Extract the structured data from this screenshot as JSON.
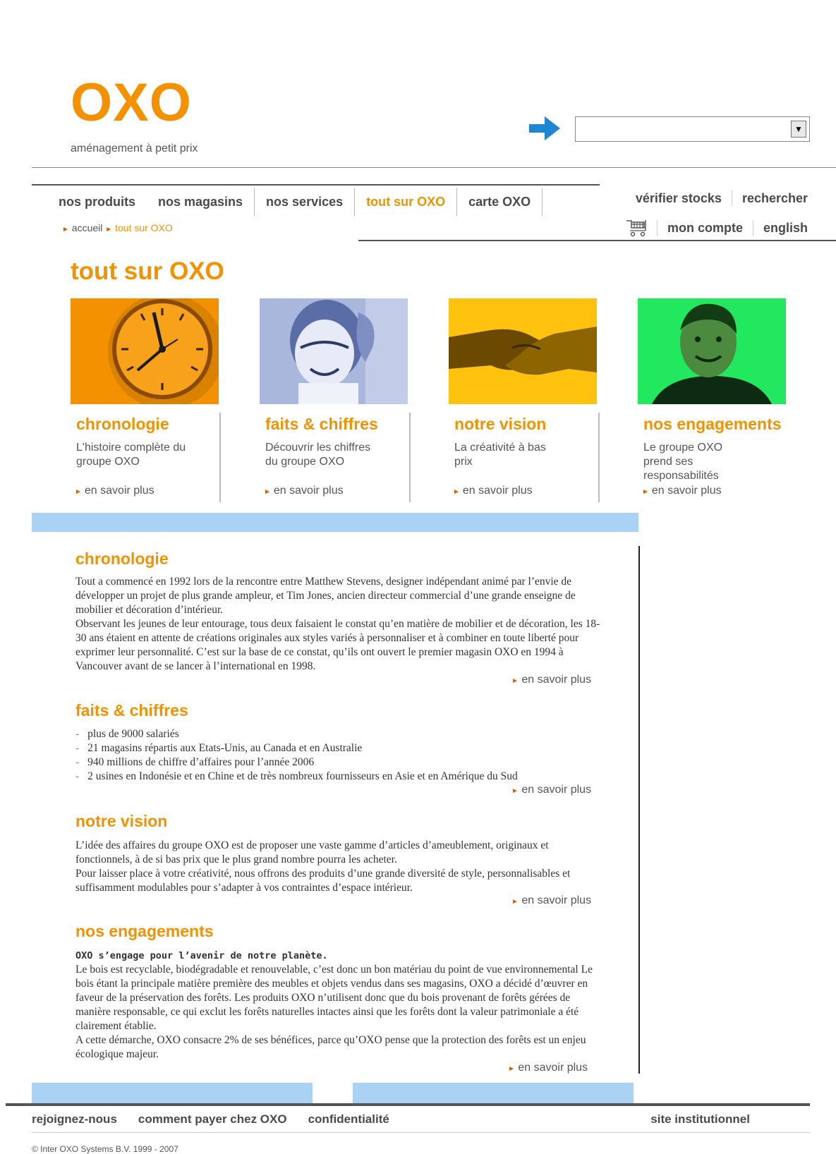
{
  "brand": {
    "logo": "OXO",
    "tagline": "aménagement à petit prix"
  },
  "search": {
    "arrow_icon": "right-arrow-icon",
    "dropdown_value": ""
  },
  "main_nav": [
    {
      "label": "nos produits",
      "active": false
    },
    {
      "label": "nos magasins",
      "active": false
    },
    {
      "label": "nos services",
      "active": false
    },
    {
      "label": "tout sur OXO",
      "active": true
    },
    {
      "label": "carte OXO",
      "active": false
    }
  ],
  "breadcrumb": {
    "items": [
      "accueil",
      "tout sur OXO"
    ]
  },
  "util_nav": {
    "check_stock": "vérifier stocks",
    "search": "rechercher",
    "account": "mon compte",
    "language": "english",
    "cart_icon": "shopping-cart-icon"
  },
  "page": {
    "title": "tout sur OXO"
  },
  "cards": [
    {
      "title": "chronologie",
      "desc": "L'histoire complète du groupe OXO",
      "more": "en savoir plus",
      "image": "clock-image",
      "color": "#f39100"
    },
    {
      "title": "faits & chiffres",
      "desc": "Découvrir les chiffres du groupe OXO",
      "more": "en savoir plus",
      "image": "child-image",
      "color": "#8a9cc7"
    },
    {
      "title": "notre vision",
      "desc": "La créativité à bas prix",
      "more": "en savoir plus",
      "image": "handshake-image",
      "color": "#f8c400"
    },
    {
      "title": "nos engagements",
      "desc": "Le groupe OXO prend ses responsabilités",
      "more": "en savoir plus",
      "image": "man-portrait-image",
      "color": "#1fe85a"
    }
  ],
  "sections": {
    "chronologie": {
      "title": "chronologie",
      "paragraphs": [
        "Tout a commencé en 1992 lors de la rencontre entre Matthew Stevens, designer indépendant animé par l’envie de développer un projet de plus grande ampleur, et Tim Jones, ancien directeur commercial d’une grande enseigne de mobilier et décoration d’intérieur.",
        "Observant les jeunes de leur entourage, tous deux faisaient le constat qu’en matière de mobilier et de décoration, les 18-30 ans étaient en attente de créations originales aux styles variés à personnaliser et à combiner en toute liberté pour exprimer leur personnalité. C’est sur la base de ce constat, qu’ils ont ouvert le premier magasin OXO en 1994 à Vancouver avant de se lancer à l’international en 1998."
      ],
      "more": "en savoir plus"
    },
    "faits": {
      "title": "faits & chiffres",
      "items": [
        "plus de 9000 salariés",
        "21 magasins répartis aux Etats-Unis, au Canada et en Australie",
        "940 millions de chiffre d’affaires pour l’année 2006",
        "2 usines en Indonésie et en Chine et de très nombreux fournisseurs en Asie et en Amérique du Sud"
      ],
      "more": "en savoir plus"
    },
    "vision": {
      "title": "notre vision",
      "paragraphs": [
        "L’idée des affaires du groupe OXO est de proposer une vaste gamme d’articles d’ameublement, originaux et fonctionnels, à de si bas prix que le plus grand nombre pourra les acheter.",
        "Pour laisser place à votre créativité, nous offrons des produits d’une grande diversité de style, personnalisables et suffisamment modulables pour s’adapter à vos contraintes d’espace intérieur."
      ],
      "more": "en savoir plus"
    },
    "engagements": {
      "title": "nos engagements",
      "lead": "OXO s’engage pour l’avenir de notre planète.",
      "paragraphs": [
        "Le bois est recyclable, biodégradable et renouvelable, c’est donc un bon matériau du point de vue environnemental Le bois étant la principale matière première des meubles et objets vendus dans ses magasins, OXO a décidé d’œuvrer en faveur de la préservation des forêts. Les produits OXO n’utilisent donc que du bois provenant de forêts gérées de manière responsable, ce qui exclut les forêts naturelles intactes ainsi que les forêts dont la valeur patrimoniale a été clairement établie.",
        "A cette démarche, OXO consacre 2% de ses bénéfices, parce qu’OXO pense que la protection des forêts est un enjeu écologique majeur."
      ],
      "more": "en savoir plus"
    }
  },
  "footer": {
    "links": [
      "rejoignez-nous",
      "comment payer chez OXO",
      "confidentialité"
    ],
    "right_link": "site institutionnel",
    "copyright": "© Inter OXO Systems B.V. 1999 - 2007"
  },
  "colors": {
    "accent": "#f39100",
    "bar": "#a9d2f5",
    "text": "#4a4a4a"
  }
}
